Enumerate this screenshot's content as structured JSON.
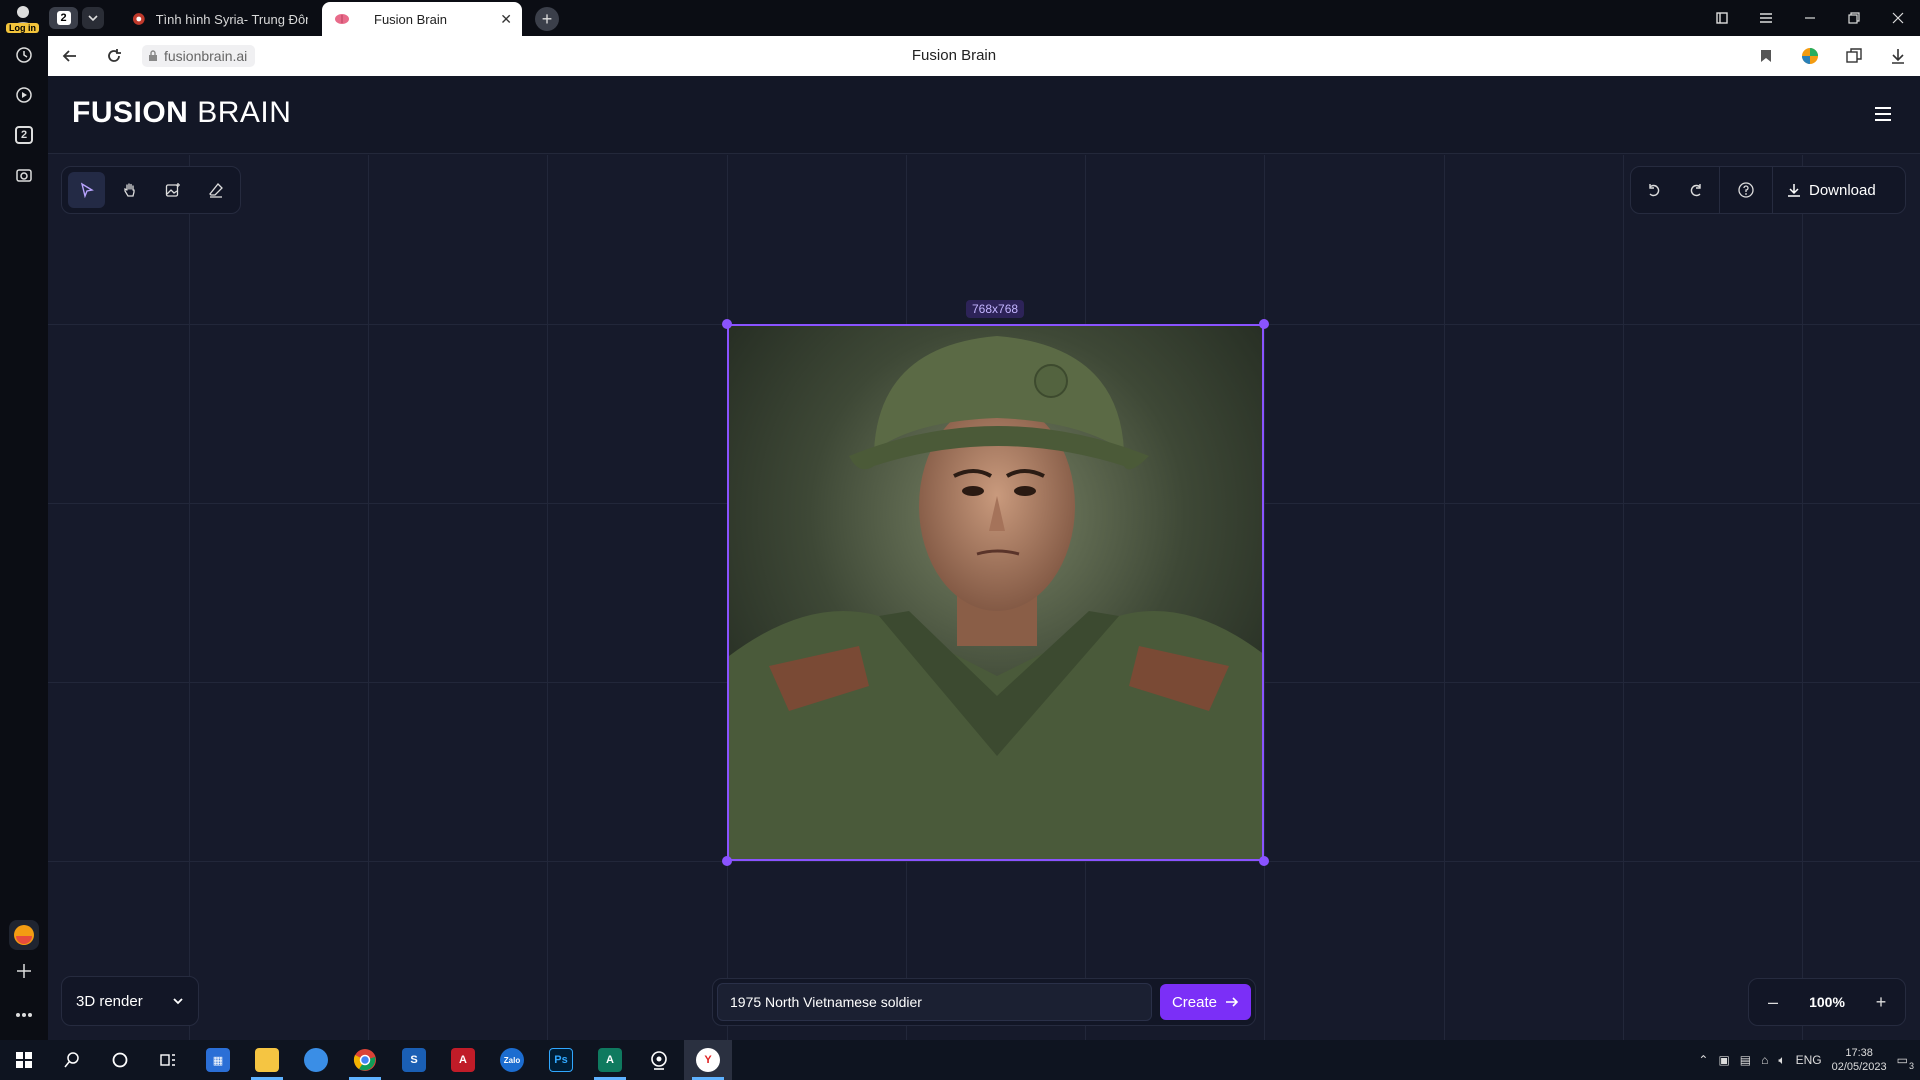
{
  "browser": {
    "profile_badge": "Log in",
    "tab_count": "2",
    "tabs": [
      {
        "title": "Tình hình Syria- Trung Đôn"
      },
      {
        "title": "Fusion Brain"
      }
    ],
    "url": "fusionbrain.ai",
    "page_title": "Fusion Brain"
  },
  "side_panel": {
    "tabs_badge": "2"
  },
  "app": {
    "logo_bold": "FUSION",
    "logo_light": "BRAIN",
    "toolbar": {
      "tools": [
        "select-tool",
        "hand-tool",
        "add-image-tool",
        "eraser-tool"
      ],
      "download_label": "Download"
    },
    "canvas_image": {
      "dimensions_label": "768x768",
      "subject": "portrait of a soldier in green uniform and bush hat"
    },
    "style_selector": {
      "value": "3D render"
    },
    "prompt": {
      "value": "1975 North Vietnamese soldier",
      "create_label": "Create"
    },
    "zoom": {
      "value": "100%",
      "minus": "–",
      "plus": "+"
    }
  },
  "taskbar": {
    "language": "ENG",
    "time": "17:38",
    "date": "02/05/2023",
    "notifications": "3"
  },
  "colors": {
    "accent": "#8a53ff",
    "create_button": "#7b2ff7",
    "canvas_bg": "#161a2b"
  }
}
